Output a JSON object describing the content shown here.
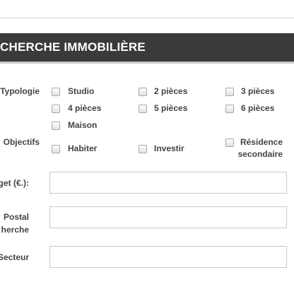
{
  "header": {
    "title": "CHERCHE IMMOBILIÈRE"
  },
  "typologie": {
    "label": "Typologie",
    "options": [
      "Studio",
      "2 pièces",
      "3 pièces",
      "4 pièces",
      "5 pièces",
      "6 pièces",
      "Maison"
    ]
  },
  "objectifs": {
    "label": "Objectifs",
    "options": [
      "Habiter",
      "Investir"
    ],
    "residence_line1": "Résidence",
    "residence_line2": "secondaire"
  },
  "budget": {
    "label": "get (€.):",
    "value": ""
  },
  "code_postal": {
    "label_line1": "Postal",
    "label_line2": "herche",
    "value": ""
  },
  "secteur": {
    "label": "Secteur",
    "value": ""
  }
}
